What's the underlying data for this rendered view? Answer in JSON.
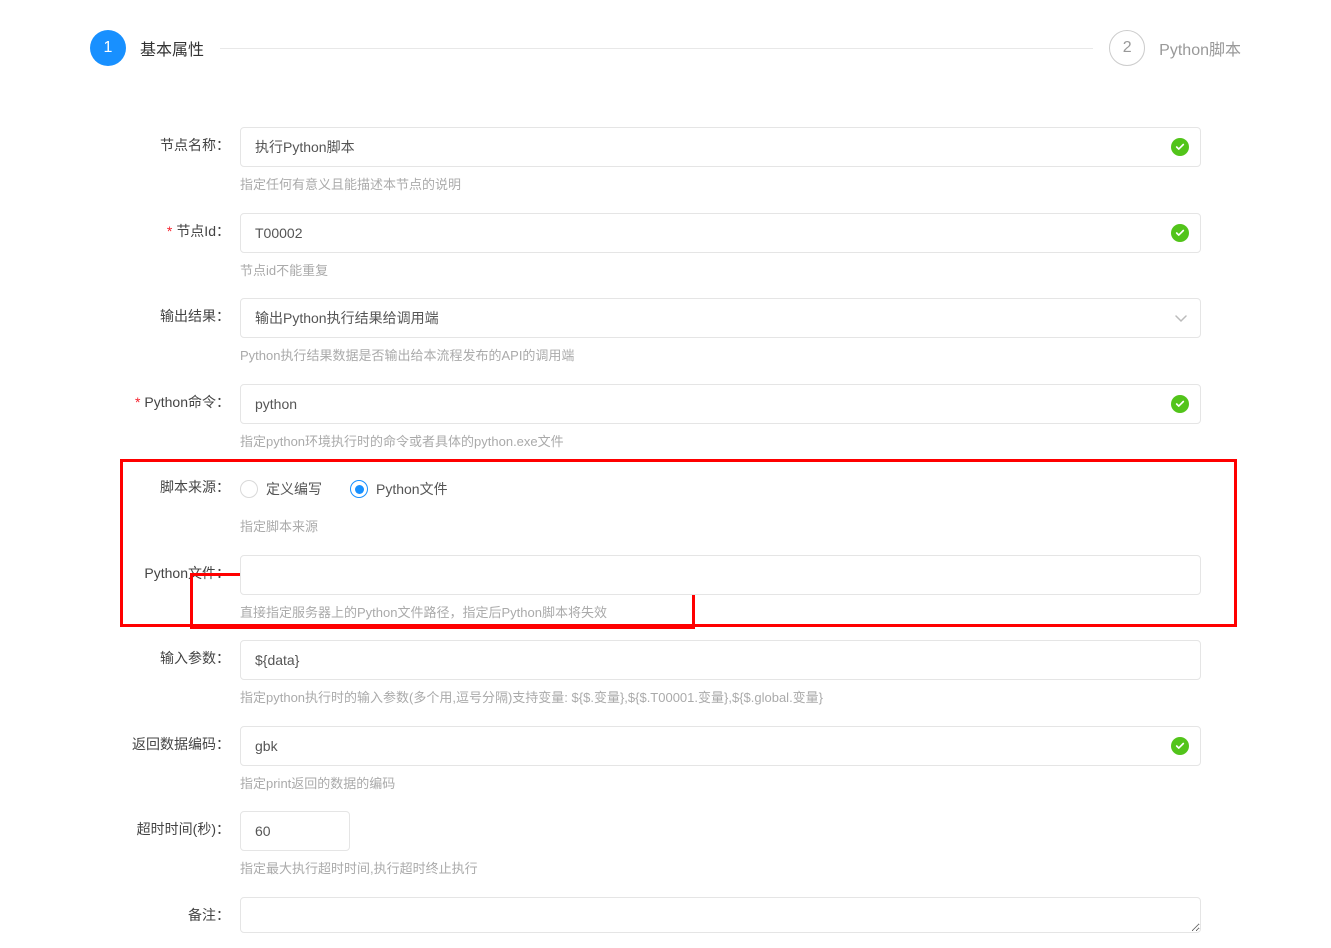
{
  "stepper": {
    "step1": {
      "num": "1",
      "label": "基本属性"
    },
    "step2": {
      "num": "2",
      "label": "Python脚本"
    }
  },
  "form": {
    "nodeName": {
      "label": "节点名称：",
      "value": "执行Python脚本",
      "hint": "指定任何有意义且能描述本节点的说明"
    },
    "nodeId": {
      "label": "节点Id：",
      "value": "T00002",
      "hint": "节点id不能重复"
    },
    "outputResult": {
      "label": "输出结果：",
      "value": "输出Python执行结果给调用端",
      "hint": "Python执行结果数据是否输出给本流程发布的API的调用端"
    },
    "pythonCmd": {
      "label": "Python命令：",
      "value": "python",
      "hint": "指定python环境执行时的命令或者具体的python.exe文件"
    },
    "scriptSource": {
      "label": "脚本来源：",
      "option1": "定义编写",
      "option2": "Python文件",
      "hint": "指定脚本来源"
    },
    "pythonFile": {
      "label": "Python文件：",
      "value": "",
      "hint": "直接指定服务器上的Python文件路径，指定后Python脚本将失效"
    },
    "inputParams": {
      "label": "输入参数：",
      "value": "${data}",
      "hint": "指定python执行时的输入参数(多个用,逗号分隔)支持变量: ${$.变量},${$.T00001.变量},${$.global.变量}"
    },
    "returnEncoding": {
      "label": "返回数据编码：",
      "value": "gbk",
      "hint": "指定print返回的数据的编码"
    },
    "timeout": {
      "label": "超时时间(秒)：",
      "value": "60",
      "hint": "指定最大执行超时时间,执行超时终止执行"
    },
    "remark": {
      "label": "备注：",
      "value": ""
    }
  }
}
